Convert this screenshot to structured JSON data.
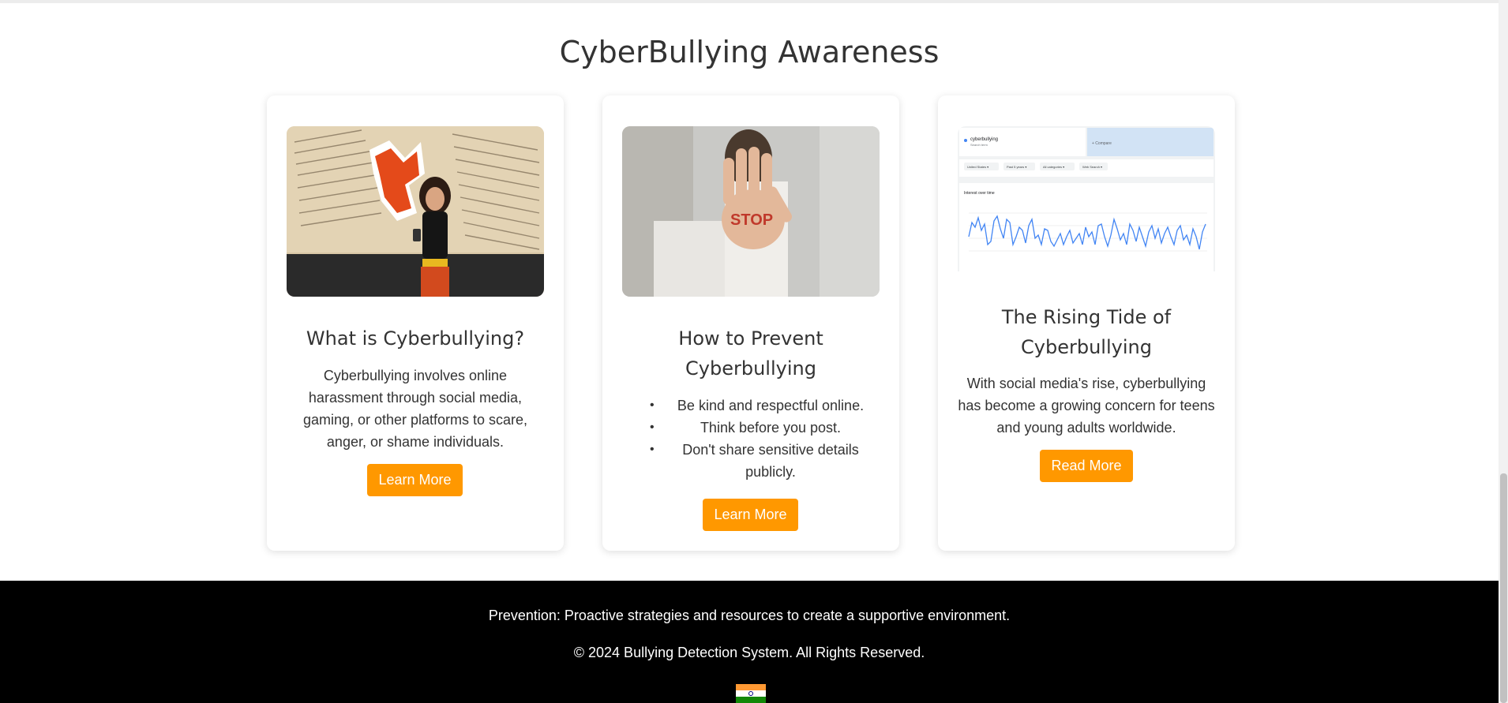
{
  "page": {
    "title": "CyberBullying Awareness"
  },
  "cards": [
    {
      "title": "What is Cyberbullying?",
      "text": "Cyberbullying involves online harassment through social media, gaming, or other platforms to scare, anger, or shame individuals.",
      "button": "Learn More",
      "image": "woman-shocked-phone-collage"
    },
    {
      "title": "How to Prevent Cyberbullying",
      "tips": [
        "Be kind and respectful online.",
        "Think before you post.",
        "Don't share sensitive details publicly."
      ],
      "button": "Learn More",
      "image": "stop-hand",
      "image_text": "STOP"
    },
    {
      "title": "The Rising Tide of Cyberbullying",
      "text": "With social media's rise, cyberbullying has become a growing concern for teens and young adults worldwide.",
      "button": "Read More",
      "image": "google-trends-chart",
      "trends": {
        "term": "cyberbullying",
        "term_sub": "Search term",
        "compare": "+ Compare",
        "filters": [
          "United States ▾",
          "Past 5 years ▾",
          "All categories ▾",
          "Web Search ▾"
        ],
        "panel_title": "Interest over time"
      }
    }
  ],
  "footer": {
    "line1": "Prevention: Proactive strategies and resources to create a supportive environment.",
    "line2": "© 2024 Bullying Detection System. All Rights Reserved.",
    "flag": "india-flag"
  },
  "colors": {
    "accent": "#ff9800",
    "footer_bg": "#000000"
  }
}
